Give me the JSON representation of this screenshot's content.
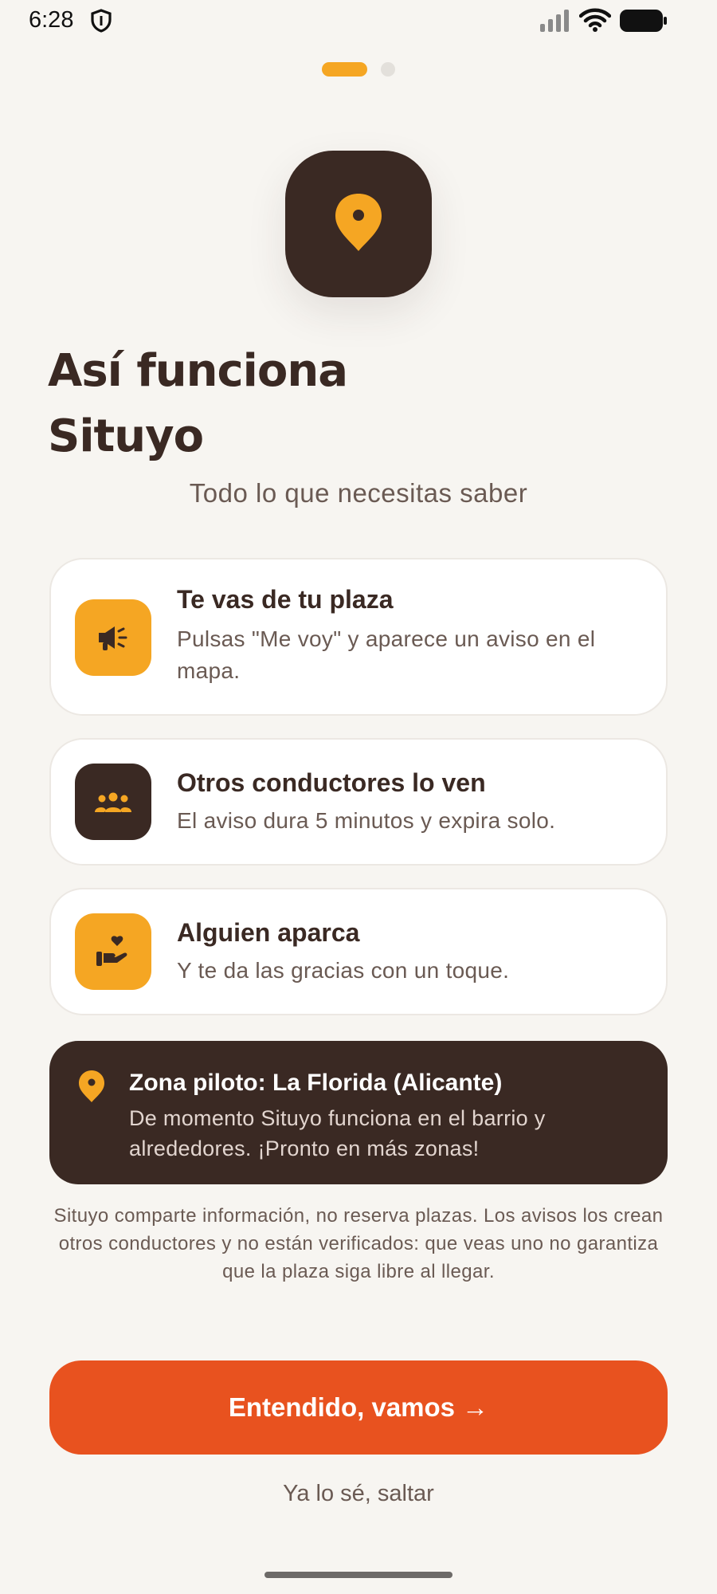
{
  "status_bar": {
    "time": "6:28",
    "icons": [
      "shield-icon",
      "signal-icon",
      "wifi-icon",
      "battery-icon"
    ]
  },
  "pager": {
    "total_pages": 2,
    "current_page": 1
  },
  "hero": {
    "icon": "location-pin-icon"
  },
  "header": {
    "title_line1": "Así funciona",
    "title_line2": "Situyo",
    "subtitle": "Todo lo que necesitas saber"
  },
  "steps": [
    {
      "icon": "megaphone-icon",
      "title": "Te vas de tu plaza",
      "text": "Pulsas \"Me voy\" y aparece un aviso en el mapa."
    },
    {
      "icon": "people-group-icon",
      "title": "Otros conductores lo ven",
      "text": "El aviso dura 5 minutos y expira solo."
    },
    {
      "icon": "hand-heart-icon",
      "title": "Alguien aparca",
      "text": "Y te da las gracias con un toque."
    }
  ],
  "pilot": {
    "icon": "location-pin-icon",
    "title": "Zona piloto: La Florida (Alicante)",
    "text": "De momento Situyo funciona en el barrio y alrededores. ¡Pronto en más zonas!"
  },
  "disclaimer": "Situyo comparte información, no reserva plazas. Los avisos los crean otros conductores y no están verificados: que veas uno no garantiza que la plaza siga libre al llegar.",
  "actions": {
    "primary_label": "Entendido, vamos →",
    "skip_label": "Ya lo sé, saltar"
  },
  "colors": {
    "background": "#F7F5F1",
    "brown": "#3A2923",
    "amber": "#F5A623",
    "orange": "#E8521F",
    "muted_text": "#6A5A53"
  }
}
